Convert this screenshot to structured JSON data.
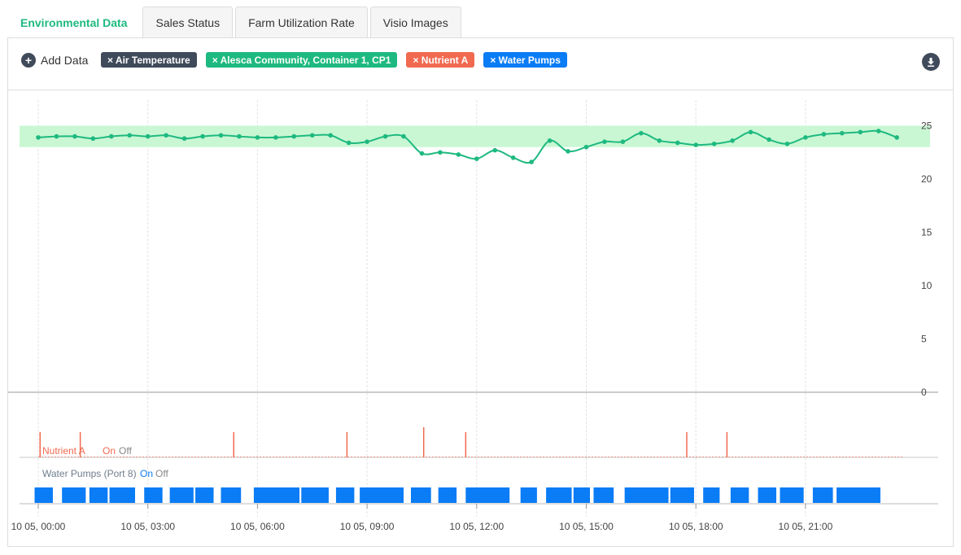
{
  "tabs": [
    {
      "label": "Environmental Data",
      "active": true
    },
    {
      "label": "Sales Status",
      "active": false
    },
    {
      "label": "Farm Utilization Rate",
      "active": false
    },
    {
      "label": "Visio Images",
      "active": false
    }
  ],
  "toolbar": {
    "add_data_label": "Add Data",
    "chips": [
      {
        "label": "× Air Temperature",
        "color": "#3f4a5a"
      },
      {
        "label": "× Alesca Community, Container 1, CP1",
        "color": "#1eb980"
      },
      {
        "label": "× Nutrient A",
        "color": "#f16a50"
      },
      {
        "label": "× Water Pumps",
        "color": "#0a7cf5"
      }
    ]
  },
  "colors": {
    "line": "#1eb980",
    "band": "#c9f7d3",
    "nutrient": "#f16a50",
    "pump": "#0a7cf5",
    "grid": "#e3e3e3"
  },
  "chart_data": {
    "type": "line",
    "x_ticks": [
      "10 05, 00:00",
      "10 05, 03:00",
      "10 05, 06:00",
      "10 05, 09:00",
      "10 05, 12:00",
      "10 05, 15:00",
      "10 05, 18:00",
      "10 05, 21:00"
    ],
    "x_range_hours": [
      0,
      24
    ],
    "y_ticks": [
      "0",
      "5",
      "10",
      "15",
      "20",
      "25"
    ],
    "ylim": [
      0,
      27.5
    ],
    "band": [
      23,
      25
    ],
    "grid": true,
    "series": [
      {
        "x": [
          0,
          0.5,
          1,
          1.5,
          2,
          2.5,
          3,
          3.5,
          4,
          4.5,
          5,
          5.5,
          6,
          6.5,
          7,
          7.5,
          8,
          8.5,
          9,
          9.5,
          10,
          10.5,
          11,
          11.5,
          12,
          12.5,
          13,
          13.5,
          14,
          14.5,
          15,
          15.5,
          16,
          16.5,
          17,
          17.5,
          18,
          18.5,
          19,
          19.5,
          20,
          20.5,
          21,
          21.5,
          22,
          22.5,
          23,
          23.5
        ],
        "values": [
          23.9,
          24.0,
          24.0,
          23.8,
          24.0,
          24.1,
          24.0,
          24.1,
          23.8,
          24.0,
          24.1,
          24.0,
          23.9,
          23.9,
          24.0,
          24.1,
          24.1,
          23.4,
          23.5,
          24.0,
          24.0,
          22.4,
          22.5,
          22.3,
          21.9,
          22.7,
          22.0,
          21.6,
          23.6,
          22.6,
          23.0,
          23.5,
          23.5,
          24.3,
          23.6,
          23.4,
          23.2,
          23.3,
          23.6,
          24.4,
          23.7,
          23.3,
          23.9,
          24.2,
          24.3,
          24.4,
          24.5,
          23.9
        ]
      }
    ],
    "nutrient": {
      "name": "Nutrient A",
      "on_label": "On",
      "off_label": "Off",
      "pulses": [
        0.05,
        1.15,
        5.35,
        8.45,
        10.55,
        11.7,
        17.75,
        18.85
      ]
    },
    "pumps": {
      "name": "Water Pumps (Port 8)",
      "on_label": "On",
      "off_label": "Off",
      "on_periods": [
        [
          -0.1,
          0.4
        ],
        [
          0.65,
          1.3
        ],
        [
          1.4,
          1.9
        ],
        [
          1.95,
          2.65
        ],
        [
          2.9,
          3.4
        ],
        [
          3.6,
          4.25
        ],
        [
          4.3,
          4.8
        ],
        [
          5.0,
          5.55
        ],
        [
          5.9,
          7.15
        ],
        [
          7.2,
          7.95
        ],
        [
          8.15,
          8.65
        ],
        [
          8.8,
          10.0
        ],
        [
          10.2,
          10.75
        ],
        [
          10.95,
          11.45
        ],
        [
          11.7,
          12.9
        ],
        [
          13.2,
          13.65
        ],
        [
          13.9,
          14.6
        ],
        [
          14.65,
          15.1
        ],
        [
          15.2,
          15.75
        ],
        [
          16.05,
          17.25
        ],
        [
          17.3,
          17.95
        ],
        [
          18.2,
          18.65
        ],
        [
          18.95,
          19.45
        ],
        [
          19.7,
          20.2
        ],
        [
          20.3,
          20.95
        ],
        [
          21.2,
          21.75
        ],
        [
          21.85,
          23.05
        ]
      ]
    }
  }
}
